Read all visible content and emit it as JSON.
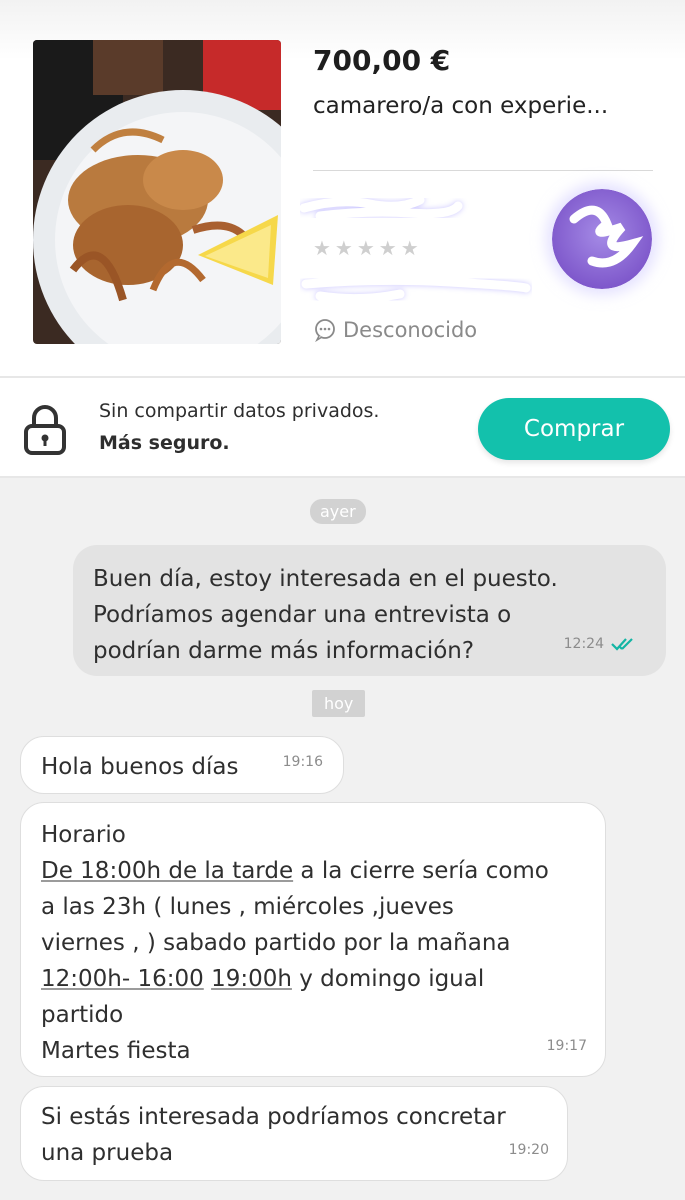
{
  "listing": {
    "price": "700,00 €",
    "title": "camarero/a con experie...",
    "rating_stars": "★★★★★",
    "seller_status": "Desconocido"
  },
  "safety": {
    "line1": "Sin compartir datos privados.",
    "line2": "Más seguro.",
    "buy_label": "Comprar"
  },
  "chat": {
    "dates": {
      "yesterday": "ayer",
      "today": "hoy"
    },
    "outgoing": {
      "text": "Buen día, estoy interesada en el puesto.\nPodríamos agendar una entrevista o\npodrían darme más información?",
      "time": "12:24"
    },
    "incoming": [
      {
        "text": "Hola buenos días",
        "time": "19:16"
      },
      {
        "line1": "Horario",
        "link1": "De 18:00h de la tarde",
        "after_link1": " a la cierre sería como",
        "line3": "a las 23h ( lunes , miércoles ,jueves",
        "line4": "viernes , ) sabado partido por la mañana",
        "link2": "12:00h- 16:00",
        "between_links": " ",
        "link3": "19:00h",
        "after_link3": " y domingo igual",
        "line6": "partido",
        "line7": "Martes fiesta",
        "time": "19:17"
      },
      {
        "text": "Si estás interesada podríamos concretar\nuna prueba",
        "time": "19:20"
      }
    ]
  },
  "colors": {
    "accent": "#13c1ac",
    "outgoing_bubble": "#e3e3e3",
    "chat_background": "#f1f1f1",
    "avatar": "#8a6ad3"
  },
  "icons": [
    "lock-icon",
    "chat-bubble-icon",
    "double-check-icon",
    "star-icon"
  ]
}
